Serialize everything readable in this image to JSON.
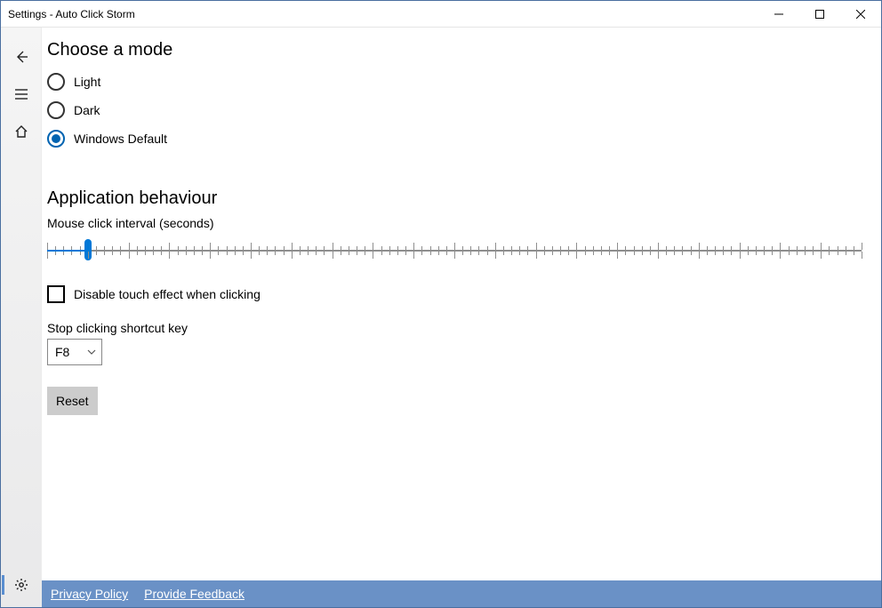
{
  "window": {
    "title": "Settings - Auto Click Storm"
  },
  "mode": {
    "heading": "Choose a mode",
    "options": [
      {
        "label": "Light",
        "selected": false
      },
      {
        "label": "Dark",
        "selected": false
      },
      {
        "label": "Windows Default",
        "selected": true
      }
    ]
  },
  "behaviour": {
    "heading": "Application behaviour",
    "interval_label": "Mouse click interval (seconds)",
    "slider": {
      "value_pct": 5
    },
    "touch_checkbox": {
      "label": "Disable touch effect when clicking",
      "checked": false
    },
    "shortcut_label": "Stop clicking shortcut key",
    "shortcut_value": "F8",
    "reset_label": "Reset"
  },
  "footer": {
    "privacy": "Privacy Policy",
    "feedback": "Provide Feedback"
  }
}
